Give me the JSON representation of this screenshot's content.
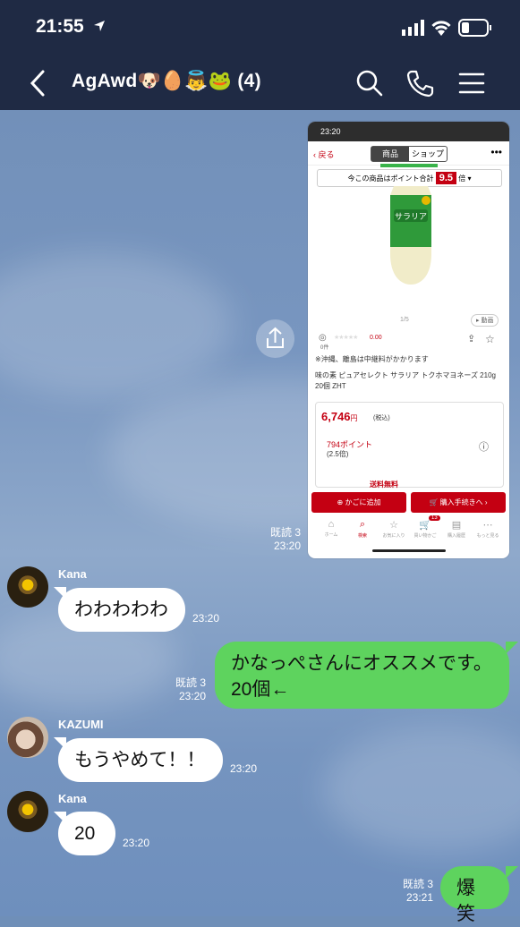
{
  "status_bar": {
    "time": "21:55"
  },
  "header": {
    "title": "AgAwd🐶🥚👼🐸 (4)"
  },
  "shared_screenshot": {
    "status_time": "23:20",
    "back_label": "戻る",
    "segment_tabs": [
      "商品",
      "ショップ"
    ],
    "points_text": "今この商品はポイント合計",
    "points_multiplier": "9.5",
    "points_suffix": "倍",
    "pager": "1/5",
    "video_label": "動画",
    "rating_value": "0.00",
    "review_count": "0件",
    "shipping_note": "※沖縄、離島は中継料がかかります",
    "product_name": "味の素 ピュアセレクト サラリア トクホマヨネーズ 210g 20個 ZHT",
    "price": "6,746",
    "price_unit": "円",
    "tax_label": "(税込)",
    "points_earned": "794ポイント",
    "points_rate": "(2.5倍)",
    "free_shipping": "送料無料",
    "cart_button": "かごに追加",
    "buy_button": "購入手続きへ",
    "tabs": [
      {
        "label": "ホーム",
        "icon": "home-icon"
      },
      {
        "label": "検索",
        "icon": "search-icon"
      },
      {
        "label": "お気に入り",
        "icon": "star-icon"
      },
      {
        "label": "買い物かご",
        "icon": "cart-icon"
      },
      {
        "label": "購入履歴",
        "icon": "receipt-icon"
      },
      {
        "label": "もっと見る",
        "icon": "more-icon"
      }
    ],
    "cart_badge": "13"
  },
  "messages": [
    {
      "type": "out-image",
      "read": "既読 3",
      "time": "23:20"
    },
    {
      "type": "in",
      "sender": "Kana",
      "text": "わわわわわ",
      "time": "23:20"
    },
    {
      "type": "out",
      "read": "既読 3",
      "text_line1": "かなっぺさんにオススメです。",
      "text_line2": "20個←",
      "time": "23:20"
    },
    {
      "type": "in",
      "sender": "KAZUMI",
      "text": "もうやめて！！",
      "time": "23:20"
    },
    {
      "type": "in",
      "sender": "Kana",
      "text": "20",
      "time": "23:20"
    },
    {
      "type": "out",
      "read": "既読 3",
      "text": "爆笑",
      "time": "23:21"
    }
  ],
  "colors": {
    "header": "#1f2a44",
    "out_bubble": "#5ed35e",
    "accent_red": "#c40012"
  }
}
